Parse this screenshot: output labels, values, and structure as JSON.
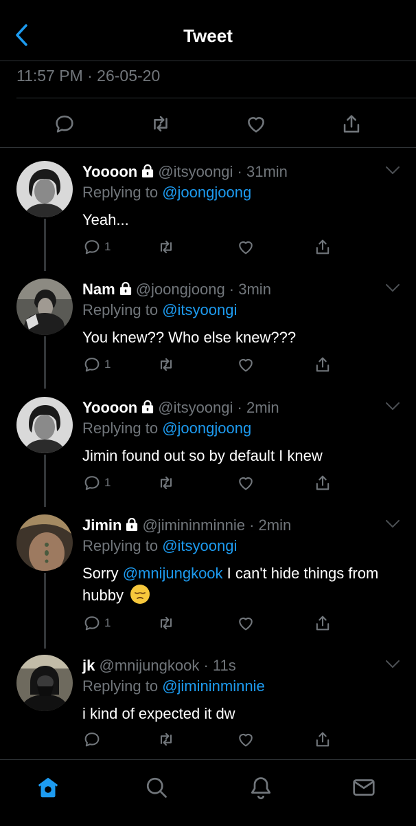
{
  "header": {
    "title": "Tweet"
  },
  "tweet_meta": {
    "timestamp": "11:57 PM · 26-05-20"
  },
  "colors": {
    "accent": "#1d9bf0",
    "muted": "#71767b",
    "divider": "#2f3336"
  },
  "replies": [
    {
      "name": "Yoooon",
      "locked": true,
      "handle": "@itsyoongi",
      "time": "31min",
      "replying_label": "Replying to",
      "replying_to": "@joongjoong",
      "text": "Yeah...",
      "reply_count": "1"
    },
    {
      "name": "Nam",
      "locked": true,
      "handle": "@joongjoong",
      "time": "3min",
      "replying_label": "Replying to",
      "replying_to": "@itsyoongi",
      "text": "You knew?? Who else knew???",
      "reply_count": "1"
    },
    {
      "name": "Yoooon",
      "locked": true,
      "handle": "@itsyoongi",
      "time": "2min",
      "replying_label": "Replying to",
      "replying_to": "@joongjoong",
      "text": "Jimin found out so by default I knew",
      "reply_count": "1"
    },
    {
      "name": "Jimin",
      "locked": true,
      "handle": "@jimininminnie",
      "time": "2min",
      "replying_label": "Replying to",
      "replying_to": "@itsyoongi",
      "text_before": "Sorry ",
      "text_mention": "@mnijungkook",
      "text_after": " I can't hide things from hubby",
      "emoji": "pensive-face",
      "reply_count": "1"
    },
    {
      "name": "jk",
      "locked": false,
      "handle": "@mnijungkook",
      "time": "11s",
      "replying_label": "Replying to",
      "replying_to": "@jimininminnie",
      "text": "i kind of expected it dw",
      "reply_count": ""
    }
  ],
  "tabbar": {
    "items": [
      "home-icon",
      "search-icon",
      "notifications-icon",
      "messages-icon"
    ]
  }
}
